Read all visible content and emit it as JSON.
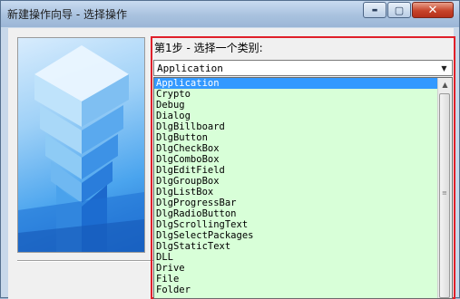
{
  "window": {
    "title": "新建操作向导 - 选择操作",
    "minimize_glyph": "▬",
    "maximize_glyph": "▢",
    "close_glyph": "✕"
  },
  "step": {
    "label": "第1步 - 选择一个类别:"
  },
  "category_combo": {
    "selected": "Application",
    "arrow_icon": "chevron-down-icon"
  },
  "category_list": {
    "items": [
      "Application",
      "Crypto",
      "Debug",
      "Dialog",
      "DlgBillboard",
      "DlgButton",
      "DlgCheckBox",
      "DlgComboBox",
      "DlgEditField",
      "DlgGroupBox",
      "DlgListBox",
      "DlgProgressBar",
      "DlgRadioButton",
      "DlgScrollingText",
      "DlgSelectPackages",
      "DlgStaticText",
      "DLL",
      "Drive",
      "File",
      "Folder"
    ],
    "selected_index": 0
  },
  "colors": {
    "highlight": "#e0202a",
    "list_background": "#d8ffd8",
    "selection": "#3399ff"
  }
}
